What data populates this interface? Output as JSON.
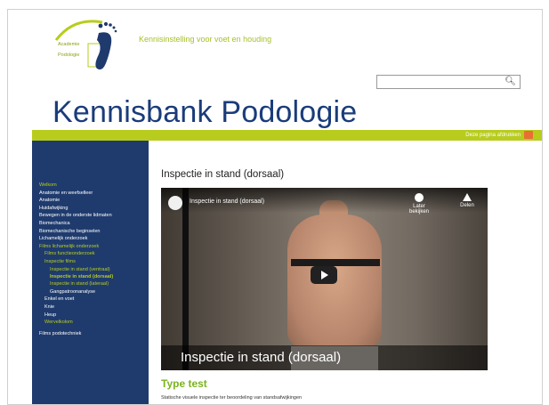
{
  "header": {
    "logo_line1": "Academie",
    "logo_line2": "Podologie",
    "tagline": "Kennisinstelling voor voet en houding",
    "site_title": "Kennisbank Podologie"
  },
  "search": {
    "value": "",
    "placeholder": "",
    "icon": "search-icon"
  },
  "toolbar": {
    "print_label": "Deze pagina afdrukken",
    "print_icon": "print-icon"
  },
  "sidebar": {
    "items": [
      {
        "label": "Welkom",
        "style": "green"
      },
      {
        "label": "Anatomie en weefselleer",
        "style": "white"
      },
      {
        "label": "Anatomie",
        "style": "white"
      },
      {
        "label": "Huidafwijking",
        "style": "white"
      },
      {
        "label": "Bewegen in de onderste lidmaten",
        "style": "white"
      },
      {
        "label": "Biomechanica",
        "style": "white"
      },
      {
        "label": "Biomechanische beginselen",
        "style": "white"
      },
      {
        "label": "Lichamelijk onderzoek",
        "style": "white"
      },
      {
        "label": "Films lichamelijk onderzoek",
        "style": "green"
      },
      {
        "label": "Films functieonderzoek",
        "style": "green",
        "level": 2
      },
      {
        "label": "Inspectie films",
        "style": "green",
        "level": 2
      },
      {
        "label": "Inspectie in stand (ventraal)",
        "style": "green",
        "level": 3
      },
      {
        "label": "Inspectie in stand (dorsaal)",
        "style": "current",
        "level": 3
      },
      {
        "label": "Inspectie in stand (lateraal)",
        "style": "green",
        "level": 3
      },
      {
        "label": "Gangpatroonanalyse",
        "style": "white",
        "level": 3
      },
      {
        "label": "Enkel en voet",
        "style": "white",
        "level": 2
      },
      {
        "label": "Knie",
        "style": "white",
        "level": 2
      },
      {
        "label": "Heup",
        "style": "white",
        "level": 2
      },
      {
        "label": "Wervelkolom",
        "style": "green",
        "level": 2
      },
      {
        "label": "Films podotechniek",
        "style": "white",
        "gap": true
      }
    ]
  },
  "main": {
    "page_title": "Inspectie in stand (dorsaal)",
    "video": {
      "top_title": "Inspectie in stand (dorsaal)",
      "watch_later": "Later bekijken",
      "share": "Delen",
      "caption": "Inspectie in stand (dorsaal)"
    },
    "type_title": "Type test",
    "type_text": "Statische visuele inspectie ter beoordeling van standsafwijkingen"
  }
}
